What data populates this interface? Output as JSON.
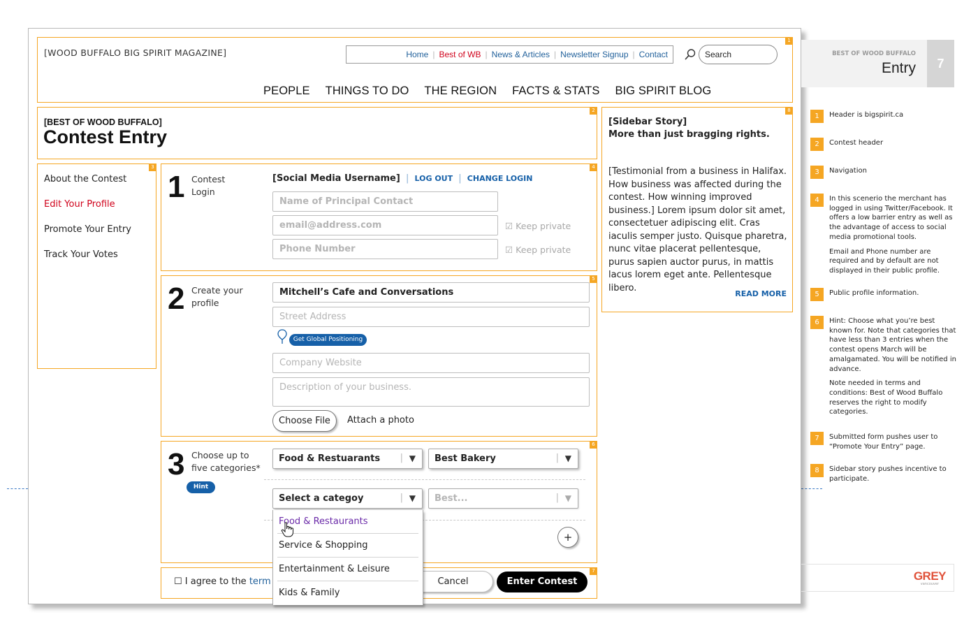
{
  "header": {
    "site_name": "[WOOD BUFFALO BIG SPIRIT MAGAZINE]",
    "top_nav": [
      "Home",
      "Best of WB",
      "News & Articles",
      "Newsletter Signup",
      "Contact"
    ],
    "search_placeholder": "Search",
    "main_nav": [
      "PEOPLE",
      "THINGS TO DO",
      "THE REGION",
      "FACTS & STATS",
      "BIG SPIRIT BLOG"
    ]
  },
  "contest_header": {
    "kicker": "[BEST OF WOOD BUFFALO]",
    "title": "Contest Entry"
  },
  "side_nav": [
    "About the Contest",
    "Edit Your Profile",
    "Promote Your Entry",
    "Track Your Votes"
  ],
  "step1": {
    "number": "1",
    "label_line1": "Contest",
    "label_line2": "Login",
    "username": "[Social Media Username]",
    "logout": "LOG OUT",
    "change_login": "CHANGE LOGIN",
    "name_placeholder": "Name of Principal Contact",
    "email_placeholder": "email@address.com",
    "phone_placeholder": "Phone Number",
    "keep_private": "☑ Keep private"
  },
  "step2": {
    "number": "2",
    "label_line1": "Create your",
    "label_line2": "profile",
    "business_name": "Mitchell’s Cafe and Conversations",
    "street_placeholder": "Street Address",
    "gps_button": "Get Global Positioning",
    "website_placeholder": "Company Website",
    "description_placeholder": "Description of your business.",
    "choose_file": "Choose File",
    "attach_photo": "Attach a photo"
  },
  "step3": {
    "number": "3",
    "label_line1": "Choose up to",
    "label_line2": "five categories*",
    "hint": "Hint",
    "row1_category": "Food & Restuarants",
    "row1_award": "Best Bakery",
    "row2_category": "Select a categoy",
    "row2_award": "Best...",
    "dropdown_options": [
      "Food & Restaurants",
      "Service & Shopping",
      "Entertainment & Leisure",
      "Kids & Family"
    ],
    "add": "+"
  },
  "footer_form": {
    "agree_prefix": "☐ I agree to the ",
    "agree_link": "term",
    "cancel": "Cancel",
    "enter": "Enter Contest"
  },
  "sidebar_story": {
    "kicker": "[Sidebar Story]",
    "headline": "More than just bragging rights.",
    "body": "[Testimonial from a business in Halifax. How business was affected during the contest. How winning improved business.] Lorem ipsum dolor sit amet, consectetuer adipiscing elit. Cras iaculis semper justo. Quisque pharetra, nunc vitae placerat pellentesque, purus sapien auctor purus, in mattis lacus lorem eget ante. Pellentesque libero.",
    "read_more": "READ MORE"
  },
  "box_numbers": [
    "1",
    "2",
    "3",
    "4",
    "5",
    "6",
    "7",
    "8"
  ],
  "panel": {
    "kicker": "BEST OF WOOD BUFFALO",
    "title": "Entry",
    "page": "7",
    "notes": [
      {
        "n": "1",
        "text": "Header is bigspirit.ca"
      },
      {
        "n": "2",
        "text": "Contest header"
      },
      {
        "n": "3",
        "text": "Navigation"
      },
      {
        "n": "4",
        "text": "In this scenerio the merchant has logged in using Twitter/Facebook. It offers a low barrier entry as well as the advantage of access to social media promotional tools.",
        "text2": "Email and Phone number are required and by default are not displayed in their public profile."
      },
      {
        "n": "5",
        "text": "Public profile information."
      },
      {
        "n": "6",
        "text": "Hint: Choose what you’re best known for. Note that categories that have less than 3 entries when the contest opens March will be amalgamated. You will be notified in advance.",
        "text2": "Note needed in terms and conditions: Best of Wood Buffalo reserves the right to modify categories."
      },
      {
        "n": "7",
        "text": "Submitted form pushes user to “Promote Your Entry” page."
      },
      {
        "n": "8",
        "text": "Sidebar story pushes incentive to participate."
      }
    ],
    "logo": "GREY",
    "logo_sub": "vancouver"
  },
  "colors": {
    "annotation_orange": "#f5a623",
    "link_blue": "#1f5f9a",
    "active_red": "#d0021b",
    "button_blue": "#1660a8"
  }
}
